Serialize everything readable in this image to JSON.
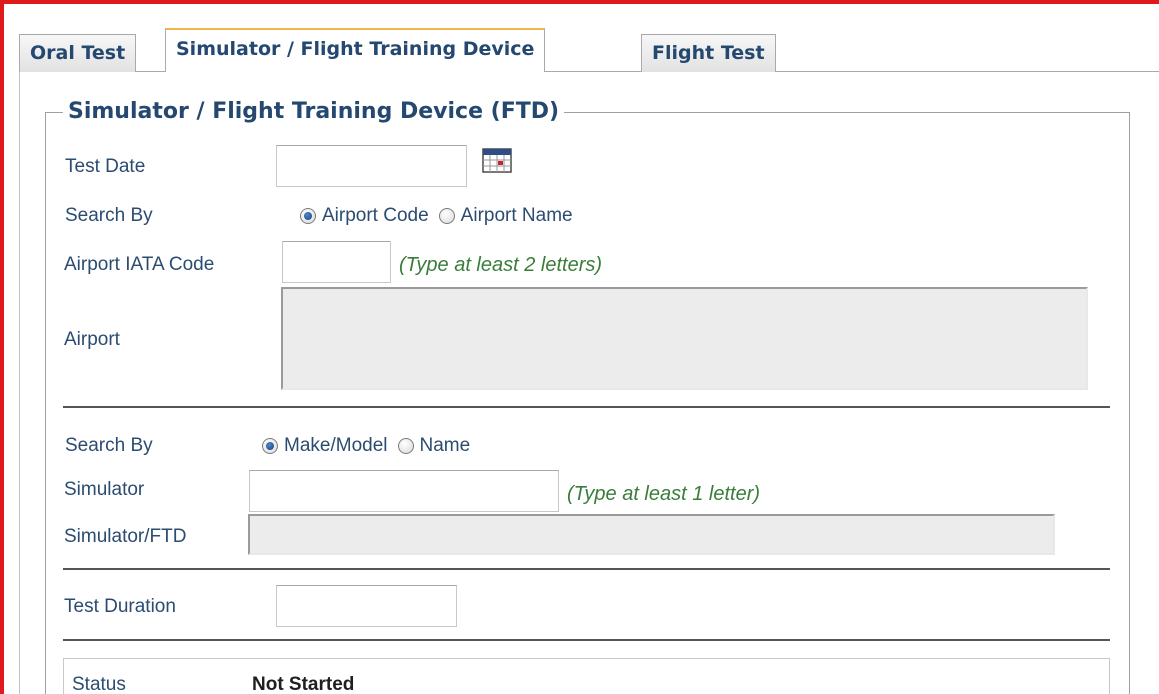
{
  "tabs": [
    {
      "label": "Oral Test"
    },
    {
      "label": "Simulator / Flight Training Device"
    },
    {
      "label": "Flight Test"
    }
  ],
  "fieldset": {
    "legend": "Simulator / Flight Training Device (FTD)"
  },
  "test_date": {
    "label": "Test Date",
    "value": ""
  },
  "airport_search": {
    "label": "Search By",
    "options": [
      {
        "label": "Airport Code",
        "checked": true
      },
      {
        "label": "Airport Name",
        "checked": false
      }
    ]
  },
  "airport_iata": {
    "label": "Airport IATA Code",
    "value": "",
    "hint": "(Type at least 2 letters)"
  },
  "airport": {
    "label": "Airport",
    "value": ""
  },
  "simulator_search": {
    "label": "Search By",
    "options": [
      {
        "label": "Make/Model",
        "checked": true
      },
      {
        "label": "Name",
        "checked": false
      }
    ]
  },
  "simulator": {
    "label": "Simulator",
    "value": "",
    "hint": "(Type at least 1 letter)"
  },
  "simulator_ftd": {
    "label": "Simulator/FTD",
    "value": ""
  },
  "test_duration": {
    "label": "Test Duration",
    "value": ""
  },
  "status": {
    "label": "Status",
    "value": "Not Started"
  },
  "colors": {
    "frame_red": "#e0191c",
    "label_blue": "#2b4c70",
    "hint_green": "#3a7d3a",
    "active_tab_accent": "#f0b548"
  },
  "icons": [
    "calendar-icon",
    "radio-button"
  ]
}
